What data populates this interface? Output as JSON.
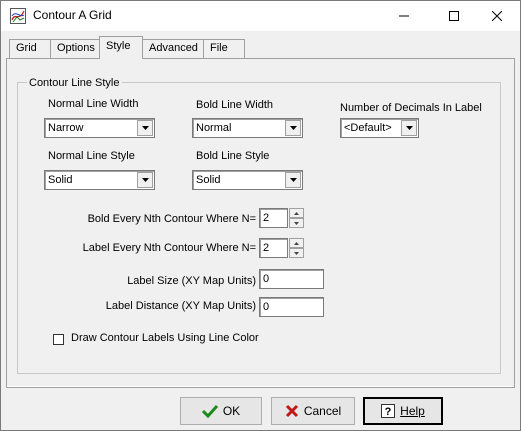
{
  "window": {
    "title": "Contour A Grid"
  },
  "tabs": [
    {
      "label": "Grid"
    },
    {
      "label": "Options"
    },
    {
      "label": "Style"
    },
    {
      "label": "Advanced"
    },
    {
      "label": "File"
    }
  ],
  "active_tab": "Style",
  "group": {
    "legend": "Contour Line  Style"
  },
  "normal_line_width": {
    "label": "Normal Line Width",
    "value": "Narrow"
  },
  "bold_line_width": {
    "label": "Bold Line Width",
    "value": "Normal"
  },
  "decimals": {
    "label": "Number of Decimals In Label",
    "value": "<Default>"
  },
  "normal_line_style": {
    "label": "Normal Line Style",
    "value": "Solid"
  },
  "bold_line_style": {
    "label": "Bold Line Style",
    "value": "Solid"
  },
  "bold_every": {
    "label": "Bold Every Nth Contour Where N=",
    "value": "2"
  },
  "label_every": {
    "label": "Label Every Nth Contour Where N=",
    "value": "2"
  },
  "label_size": {
    "label": "Label Size (XY Map Units)",
    "value": "0"
  },
  "label_distance": {
    "label": "Label Distance (XY Map Units)",
    "value": "0"
  },
  "draw_labels_color": {
    "label": "Draw Contour Labels Using Line Color",
    "checked": false
  },
  "buttons": {
    "ok": "OK",
    "cancel": "Cancel",
    "help": "Help"
  },
  "colors": {
    "ok_check": "#1a8a1a",
    "cancel_x": "#c01818"
  }
}
